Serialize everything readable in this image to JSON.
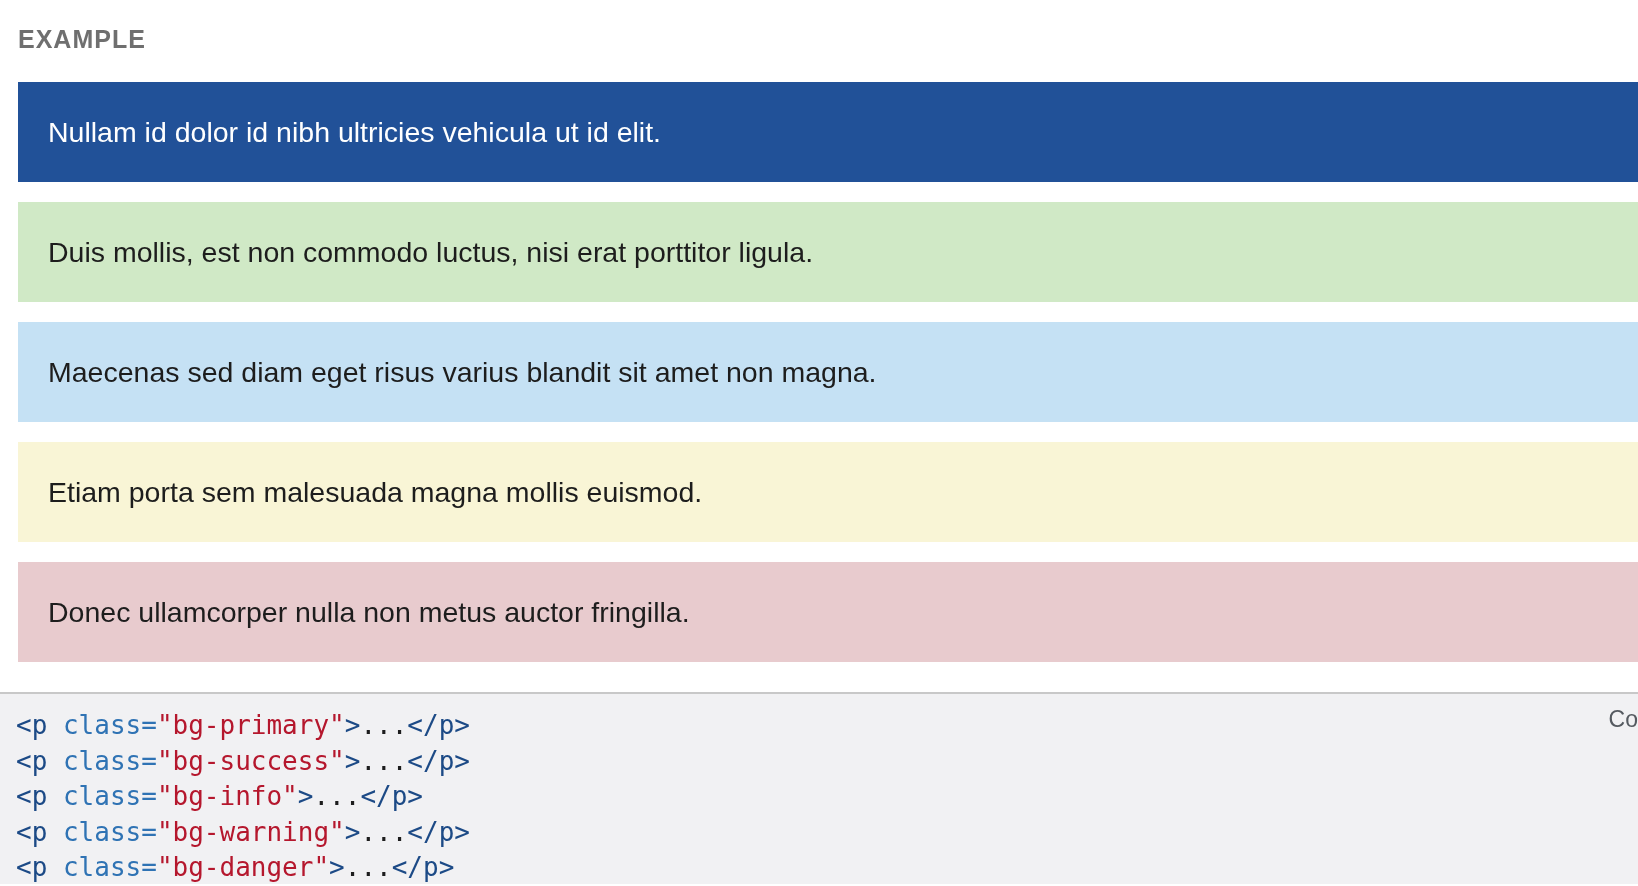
{
  "section_label": "EXAMPLE",
  "examples": [
    {
      "text": "Nullam id dolor id nibh ultricies vehicula ut id elit.",
      "color": "#215198"
    },
    {
      "text": "Duis mollis, est non commodo luctus, nisi erat porttitor ligula.",
      "color": "#d0e9c6"
    },
    {
      "text": "Maecenas sed diam eget risus varius blandit sit amet non magna.",
      "color": "#c5e1f4"
    },
    {
      "text": "Etiam porta sem malesuada magna mollis euismod.",
      "color": "#f9f5d6"
    },
    {
      "text": "Donec ullamcorper nulla non metus auctor fringilla.",
      "color": "#e8cbce"
    }
  ],
  "code": {
    "button": "Co",
    "lines": [
      [
        {
          "kind": "tag",
          "text": "<p"
        },
        {
          "kind": "attr",
          "text": " class="
        },
        {
          "kind": "string",
          "text": "\"bg-primary\""
        },
        {
          "kind": "tag",
          "text": ">"
        },
        {
          "kind": "text",
          "text": "..."
        },
        {
          "kind": "tag",
          "text": "</p>"
        }
      ],
      [
        {
          "kind": "tag",
          "text": "<p"
        },
        {
          "kind": "attr",
          "text": " class="
        },
        {
          "kind": "string",
          "text": "\"bg-success\""
        },
        {
          "kind": "tag",
          "text": ">"
        },
        {
          "kind": "text",
          "text": "..."
        },
        {
          "kind": "tag",
          "text": "</p>"
        }
      ],
      [
        {
          "kind": "tag",
          "text": "<p"
        },
        {
          "kind": "attr",
          "text": " class="
        },
        {
          "kind": "string",
          "text": "\"bg-info\""
        },
        {
          "kind": "tag",
          "text": ">"
        },
        {
          "kind": "text",
          "text": "..."
        },
        {
          "kind": "tag",
          "text": "</p>"
        }
      ],
      [
        {
          "kind": "tag",
          "text": "<p"
        },
        {
          "kind": "attr",
          "text": " class="
        },
        {
          "kind": "string",
          "text": "\"bg-warning\""
        },
        {
          "kind": "tag",
          "text": ">"
        },
        {
          "kind": "text",
          "text": "..."
        },
        {
          "kind": "tag",
          "text": "</p>"
        }
      ],
      [
        {
          "kind": "tag",
          "text": "<p"
        },
        {
          "kind": "attr",
          "text": " class="
        },
        {
          "kind": "string",
          "text": "\"bg-danger\""
        },
        {
          "kind": "tag",
          "text": ">"
        },
        {
          "kind": "text",
          "text": "..."
        },
        {
          "kind": "tag",
          "text": "</p>"
        }
      ]
    ]
  }
}
